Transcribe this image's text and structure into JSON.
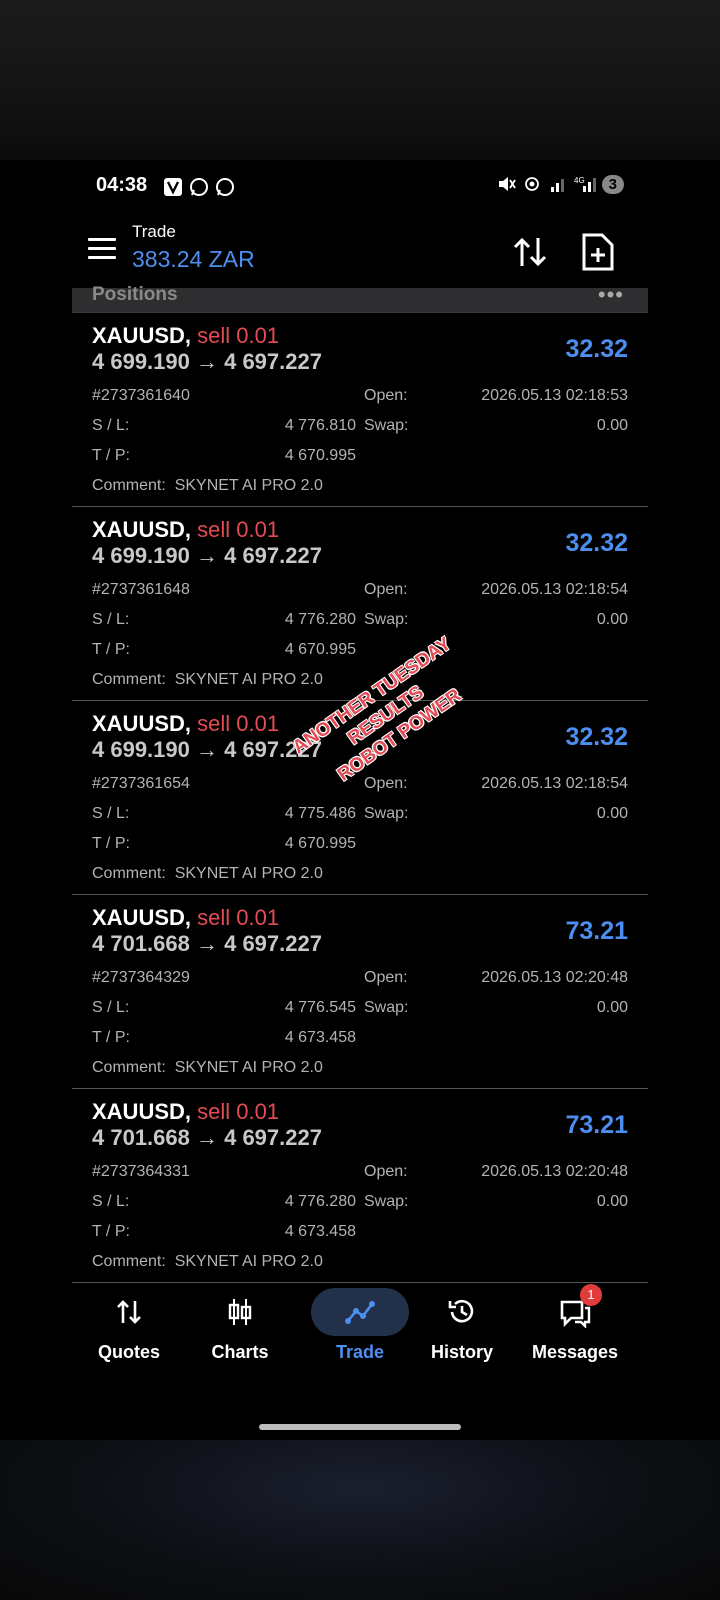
{
  "status_bar": {
    "time": "04:38",
    "battery": "3"
  },
  "header": {
    "title": "Trade",
    "balance": "383.24 ZAR"
  },
  "section": {
    "title": "Positions",
    "more": "•••"
  },
  "labels": {
    "open": "Open:",
    "sl": "S / L:",
    "swap": "Swap:",
    "tp": "T / P:",
    "comment": "Comment:"
  },
  "positions": [
    {
      "symbol": "XAUUSD,",
      "side": "sell 0.01",
      "prices": "4 699.190 → 4 697.227",
      "profit": "32.32",
      "ticket": "#2737361640",
      "open_time": "2026.05.13 02:18:53",
      "sl": "4 776.810",
      "swap": "0.00",
      "tp": "4 670.995",
      "comment": "SKYNET AI PRO 2.0"
    },
    {
      "symbol": "XAUUSD,",
      "side": "sell 0.01",
      "prices": "4 699.190 → 4 697.227",
      "profit": "32.32",
      "ticket": "#2737361648",
      "open_time": "2026.05.13 02:18:54",
      "sl": "4 776.280",
      "swap": "0.00",
      "tp": "4 670.995",
      "comment": "SKYNET AI PRO 2.0"
    },
    {
      "symbol": "XAUUSD,",
      "side": "sell 0.01",
      "prices": "4 699.190 → 4 697.227",
      "profit": "32.32",
      "ticket": "#2737361654",
      "open_time": "2026.05.13 02:18:54",
      "sl": "4 775.486",
      "swap": "0.00",
      "tp": "4 670.995",
      "comment": "SKYNET AI PRO 2.0"
    },
    {
      "symbol": "XAUUSD,",
      "side": "sell 0.01",
      "prices": "4 701.668 → 4 697.227",
      "profit": "73.21",
      "ticket": "#2737364329",
      "open_time": "2026.05.13 02:20:48",
      "sl": "4 776.545",
      "swap": "0.00",
      "tp": "4 673.458",
      "comment": "SKYNET AI PRO 2.0"
    },
    {
      "symbol": "XAUUSD,",
      "side": "sell 0.01",
      "prices": "4 701.668 → 4 697.227",
      "profit": "73.21",
      "ticket": "#2737364331",
      "open_time": "2026.05.13 02:20:48",
      "sl": "4 776.280",
      "swap": "0.00",
      "tp": "4 673.458",
      "comment": "SKYNET AI PRO 2.0"
    }
  ],
  "overlay": {
    "line1": "ANOTHER TUESDAY",
    "line2": "RESULTS",
    "line3": "ROBOT POWER"
  },
  "nav": {
    "quotes": "Quotes",
    "charts": "Charts",
    "trade": "Trade",
    "history": "History",
    "messages": "Messages",
    "messages_badge": "1"
  },
  "colors": {
    "accent": "#4d8ff0",
    "sell": "#e34b55",
    "background": "#000000"
  }
}
